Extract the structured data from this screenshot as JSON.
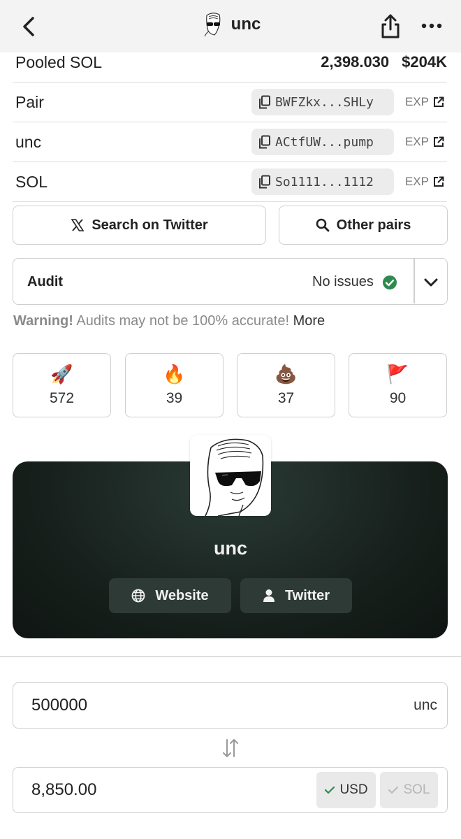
{
  "header": {
    "title": "unc"
  },
  "info_rows": {
    "pooled": {
      "label": "Pooled SOL",
      "amount": "2,398.030",
      "usd": "$204K"
    },
    "pair": {
      "label": "Pair",
      "address": "BWFZkx...SHLy",
      "exp": "EXP"
    },
    "unc": {
      "label": "unc",
      "address": "ACtfUW...pump",
      "exp": "EXP"
    },
    "sol": {
      "label": "SOL",
      "address": "So1111...1112",
      "exp": "EXP"
    }
  },
  "actions": {
    "twitter_search": "Search on Twitter",
    "other_pairs": "Other pairs"
  },
  "audit": {
    "label": "Audit",
    "status": "No issues"
  },
  "warning": {
    "bold": "Warning!",
    "text": "Audits may not be 100% accurate!",
    "more": "More"
  },
  "reactions": [
    {
      "emoji": "🚀",
      "count": "572"
    },
    {
      "emoji": "🔥",
      "count": "39"
    },
    {
      "emoji": "💩",
      "count": "37"
    },
    {
      "emoji": "🚩",
      "count": "90"
    }
  ],
  "token_card": {
    "name": "unc",
    "website": "Website",
    "twitter": "Twitter"
  },
  "converter": {
    "amount": "500000",
    "amount_unit": "unc",
    "result": "8,850.00",
    "usd_label": "USD",
    "sol_label": "SOL"
  },
  "colors": {
    "check_green": "#2f8a4f",
    "card_dark": "#17201c"
  }
}
